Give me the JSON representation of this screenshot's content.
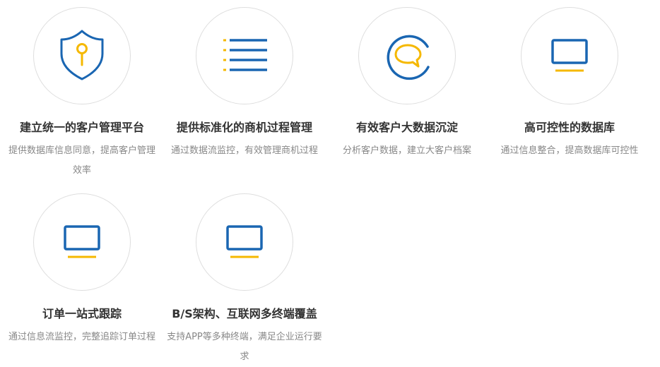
{
  "colors": {
    "blue": "#1a66b2",
    "yellow": "#f5b800",
    "circle_border": "#dedede",
    "title": "#333333",
    "desc": "#888888"
  },
  "features": [
    {
      "icon": "shield-key-icon",
      "title": "建立统一的客户管理平台",
      "desc": "提供数据库信息同意，提高客户管理效率"
    },
    {
      "icon": "list-icon",
      "title": "提供标准化的商机过程管理",
      "desc": "通过数据流监控，有效管理商机过程"
    },
    {
      "icon": "chat-bubble-icon",
      "title": "有效客户大数据沉淀",
      "desc": "分析客户数据，建立大客户档案"
    },
    {
      "icon": "monitor-icon",
      "title": "高可控性的数据库",
      "desc": "通过信息整合，提高数据库可控性"
    },
    {
      "icon": "monitor-icon",
      "title": "订单一站式跟踪",
      "desc": "通过信息流监控，完整追踪订单过程"
    },
    {
      "icon": "monitor-icon",
      "title": "B/S架构、互联网多终端覆盖",
      "desc": "支持APP等多种终端，满足企业运行要求"
    }
  ]
}
